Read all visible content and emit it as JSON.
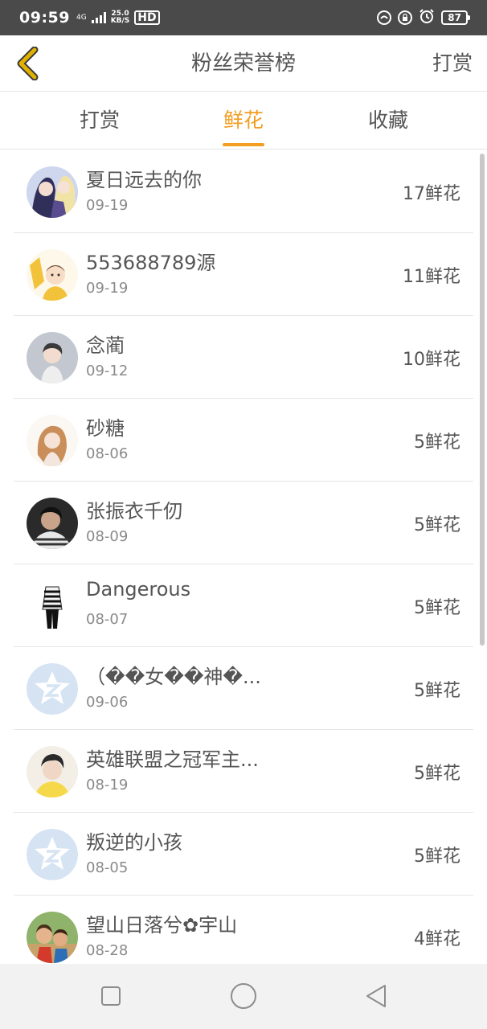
{
  "status": {
    "time": "09:59",
    "network": "4G",
    "speed_value": "25.0",
    "speed_unit": "KB/S",
    "hd": "HD",
    "battery": "87"
  },
  "header": {
    "title": "粉丝荣誉榜",
    "right_action": "打赏"
  },
  "tabs": [
    {
      "label": "打赏"
    },
    {
      "label": "鲜花"
    },
    {
      "label": "收藏"
    }
  ],
  "active_tab": "鲜花",
  "fans": [
    {
      "name": "夏日远去的你",
      "date": "09-19",
      "count": "17鲜花",
      "avatar": "anime-couple"
    },
    {
      "name": "553688789源",
      "date": "09-19",
      "count": "11鲜花",
      "avatar": "cartoon-boy"
    },
    {
      "name": "念蔺",
      "date": "09-12",
      "count": "10鲜花",
      "avatar": "boy-portrait"
    },
    {
      "name": "砂糖",
      "date": "08-06",
      "count": "5鲜花",
      "avatar": "girl-portrait"
    },
    {
      "name": "张振衣千仞",
      "date": "08-09",
      "count": "5鲜花",
      "avatar": "man-photo"
    },
    {
      "name": "Dangerous",
      "date": "08-07",
      "count": "5鲜花",
      "avatar": "striped-outfit"
    },
    {
      "name": "（��女��神�...",
      "date": "09-06",
      "count": "5鲜花",
      "avatar": "default-qq"
    },
    {
      "name": "英雄联盟之冠军主...",
      "date": "08-19",
      "count": "5鲜花",
      "avatar": "young-man"
    },
    {
      "name": "叛逆的小孩",
      "date": "08-05",
      "count": "5鲜花",
      "avatar": "default-qq"
    },
    {
      "name": "望山日落兮✿宇山",
      "date": "08-28",
      "count": "4鲜花",
      "avatar": "cartoon-kids"
    }
  ],
  "colors": {
    "accent": "#f29e22",
    "back_arrow": "#e0b000",
    "status_bar": "#4a4a4a",
    "default_avatar": "#d5e3f3"
  }
}
